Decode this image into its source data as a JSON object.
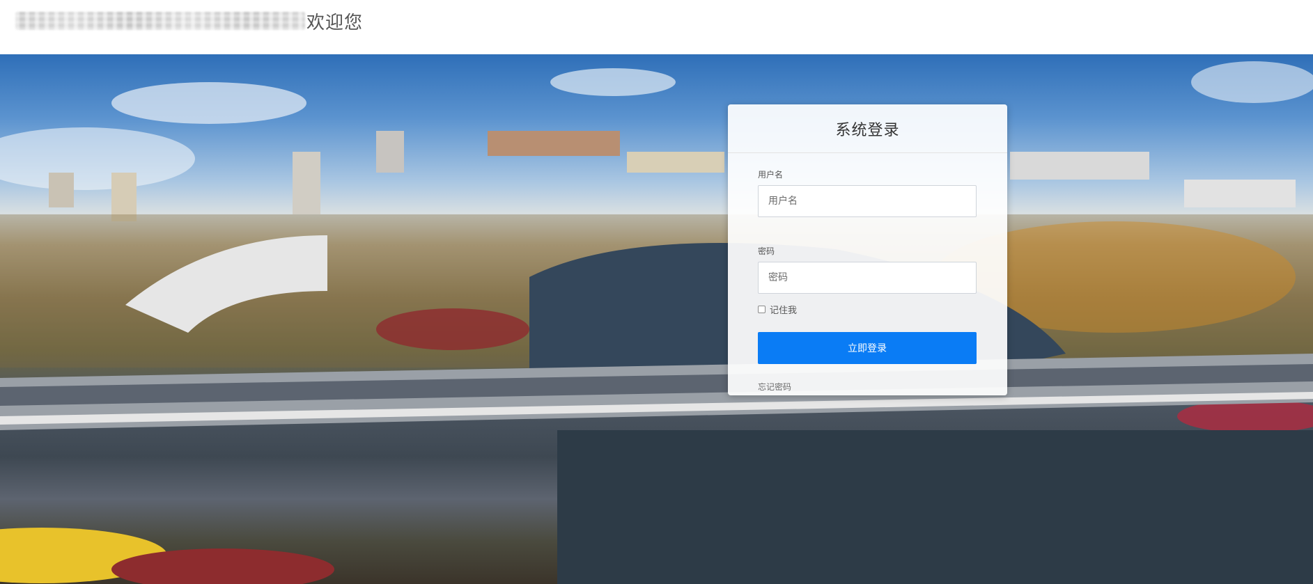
{
  "header": {
    "blurred_title": "",
    "welcome_text": "欢迎您"
  },
  "login": {
    "title": "系统登录",
    "username_label": "用户名",
    "username_placeholder": "用户名",
    "password_label": "密码",
    "password_placeholder": "密码",
    "remember_label": "记住我",
    "remember_checked": false,
    "submit_label": "立即登录",
    "forgot_label": "忘记密码"
  },
  "colors": {
    "primary": "#0a7cf5",
    "title_text": "#333333",
    "muted_text": "#555555"
  }
}
